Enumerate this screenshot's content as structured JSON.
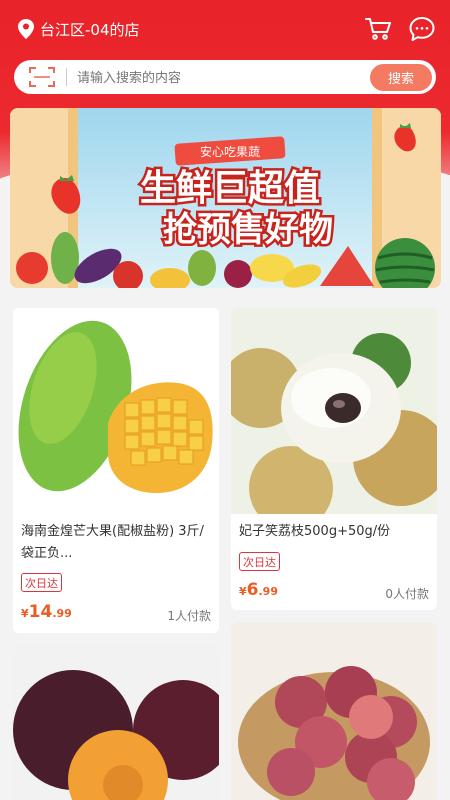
{
  "header": {
    "store_name": "台江区-04的店"
  },
  "search": {
    "placeholder": "请输入搜索的内容",
    "button_label": "搜索"
  },
  "banner": {
    "tag": "安心吃果蔬",
    "line1": "生鲜巨超值",
    "line2": "抢预售好物"
  },
  "products": [
    {
      "title": "海南金煌芒大果(配椒盐粉) 3斤/袋正负...",
      "badge": "次日达",
      "currency": "¥",
      "price_int": "14",
      "price_dec": ".99",
      "buyers": "1人付款"
    },
    {
      "title": "妃子笑荔枝500g+50g/份",
      "badge": "次日达",
      "currency": "¥",
      "price_int": "6",
      "price_dec": ".99",
      "buyers": "0人付款"
    }
  ],
  "colors": {
    "brand_red": "#e8232a",
    "search_button": "#f47a62",
    "price": "#ee5b22",
    "badge": "#d9363e"
  }
}
